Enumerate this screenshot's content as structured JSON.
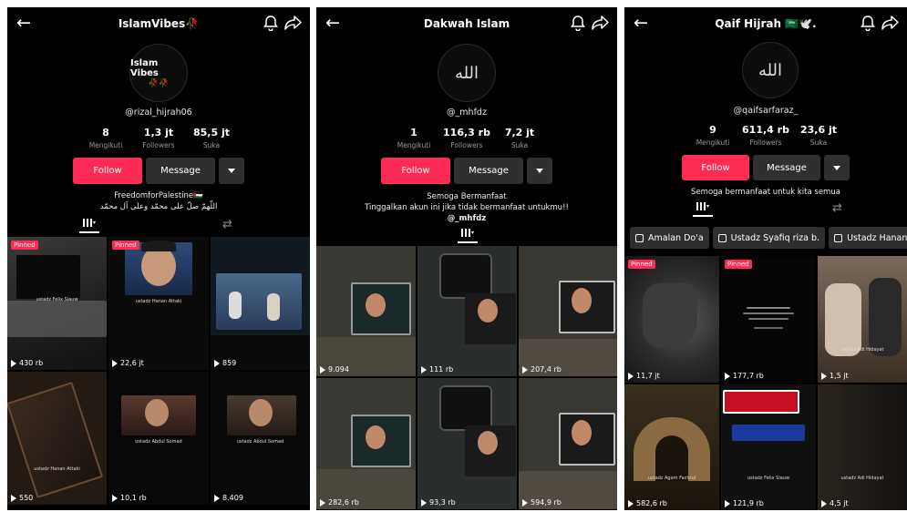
{
  "panels": [
    {
      "title": "IslamVibes🥀",
      "avatar_text": "Islam Vibes",
      "avatar_roses": "🥀🥀",
      "handle": "@rizal_hijrah06",
      "stats": [
        {
          "num": "8",
          "label": "Mengikuti"
        },
        {
          "num": "1,3 jt",
          "label": "Followers"
        },
        {
          "num": "85,5 jt",
          "label": "Suka"
        }
      ],
      "follow_label": "Follow",
      "message_label": "Message",
      "bio": [
        "FreedomforPalestine🇵🇸",
        "اللّهمّ صلّ على محمّد وعلى آل محمّد"
      ],
      "videos": [
        {
          "views": "430 rb",
          "pinned": "Pinned",
          "caption": "ustadz Felix Siauw"
        },
        {
          "views": "22,6 jt",
          "pinned": "Pinned",
          "caption": "ustadz Hanan Attaki"
        },
        {
          "views": "859",
          "pinned": "",
          "caption": ""
        },
        {
          "views": "550",
          "pinned": "",
          "caption": "ustadz Hanan Attaki"
        },
        {
          "views": "10,1 rb",
          "pinned": "",
          "caption": "ustadz Abdul Somad"
        },
        {
          "views": "8.409",
          "pinned": "",
          "caption": "ustadz Abdul Somad"
        }
      ]
    },
    {
      "title": "Dakwah Islam",
      "avatar_text": "الله",
      "handle": "@_mhfdz",
      "stats": [
        {
          "num": "1",
          "label": "Mengikuti"
        },
        {
          "num": "116,3 rb",
          "label": "Followers"
        },
        {
          "num": "7,2 jt",
          "label": "Suka"
        }
      ],
      "follow_label": "Follow",
      "message_label": "Message",
      "bio": [
        "Semoga Bermanfaat",
        "Tinggalkan akun ini jika tidak bermanfaat untukmu!!",
        "@_mhfdz"
      ],
      "videos": [
        {
          "views": "9.094",
          "pinned": ""
        },
        {
          "views": "111 rb",
          "pinned": ""
        },
        {
          "views": "207,4 rb",
          "pinned": ""
        },
        {
          "views": "282,6 rb",
          "pinned": ""
        },
        {
          "views": "93,3 rb",
          "pinned": ""
        },
        {
          "views": "594,9 rb",
          "pinned": ""
        }
      ]
    },
    {
      "title": "Qaif Hijrah 🇸🇦🕊️.",
      "avatar_text": "الله",
      "handle": "@qaifsarfaraz_",
      "stats": [
        {
          "num": "9",
          "label": "Mengikuti"
        },
        {
          "num": "611,4 rb",
          "label": "Followers"
        },
        {
          "num": "23,6 jt",
          "label": "Suka"
        }
      ],
      "follow_label": "Follow",
      "message_label": "Message",
      "bio": [
        "Semoga bermanfaat untuk kita semua"
      ],
      "playlists": [
        "Amalan Do'a",
        "Ustadz Syafiq riza b.",
        "Ustadz Hanan"
      ],
      "videos": [
        {
          "views": "11,7 jt",
          "pinned": "Pinned",
          "caption": ""
        },
        {
          "views": "177,7 rb",
          "pinned": "Pinned",
          "caption": ""
        },
        {
          "views": "1,5 jt",
          "pinned": "",
          "caption": "ustadz Adi Hidayat"
        },
        {
          "views": "582,6 rb",
          "pinned": "",
          "caption": "ustadz Agam Fachrul"
        },
        {
          "views": "121,9 rb",
          "pinned": "",
          "caption": "ustadz Felix Siauw"
        },
        {
          "views": "4,5 jt",
          "pinned": "",
          "caption": "ustadz Adi Hidayat"
        }
      ]
    }
  ]
}
